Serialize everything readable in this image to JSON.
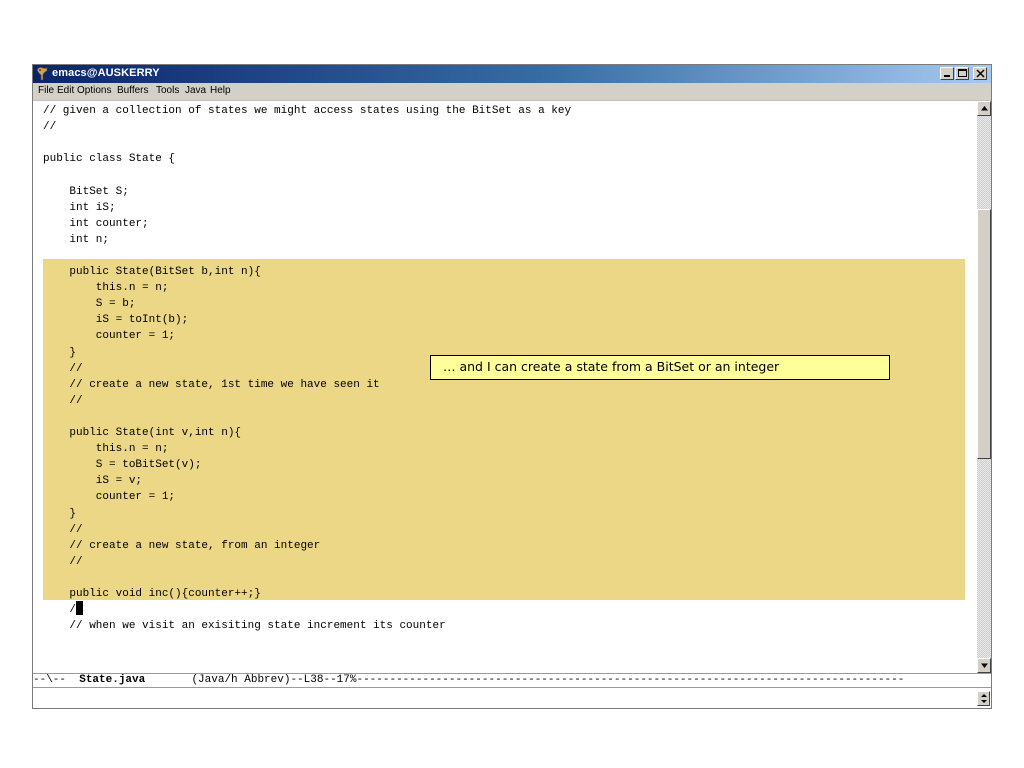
{
  "window": {
    "title": "emacs@AUSKERRY",
    "buttons": {
      "minimize": "minimize",
      "maximize": "maximize",
      "close": "close"
    }
  },
  "menu": [
    "File",
    "Edit",
    "Options",
    "Buffers",
    "Tools",
    "Java",
    "Help"
  ],
  "editor": {
    "lines": [
      "// given a collection of states we might access states using the BitSet as a key",
      "//",
      "",
      "public class State {",
      "",
      "    BitSet S;",
      "    int iS;",
      "    int counter;",
      "    int n;",
      "",
      "    public State(BitSet b,int n){",
      "        this.n = n;",
      "        S = b;",
      "        iS = toInt(b);",
      "        counter = 1;",
      "    }",
      "    //",
      "    // create a new state, 1st time we have seen it",
      "    //",
      "",
      "    public State(int v,int n){",
      "        this.n = n;",
      "        S = toBitSet(v);",
      "        iS = v;",
      "        counter = 1;",
      "    }",
      "    //",
      "    // create a new state, from an integer",
      "    //",
      "",
      "    public void inc(){counter++;}",
      "    //",
      "    // when we visit an exisiting state increment its counter"
    ],
    "highlight_color": "#ecd786"
  },
  "callout": {
    "text": "… and I can create a state from a BitSet or an integer",
    "background": "#ffff99"
  },
  "modeline": {
    "prefix": "--\\--  ",
    "buffer_name": "State.java",
    "rest": "       (Java/h Abbrev)--L38--17%-----------------------------------------------------------------------------------"
  },
  "scrollbar": {
    "position_fraction": 0.19,
    "visible_fraction": 0.44
  }
}
